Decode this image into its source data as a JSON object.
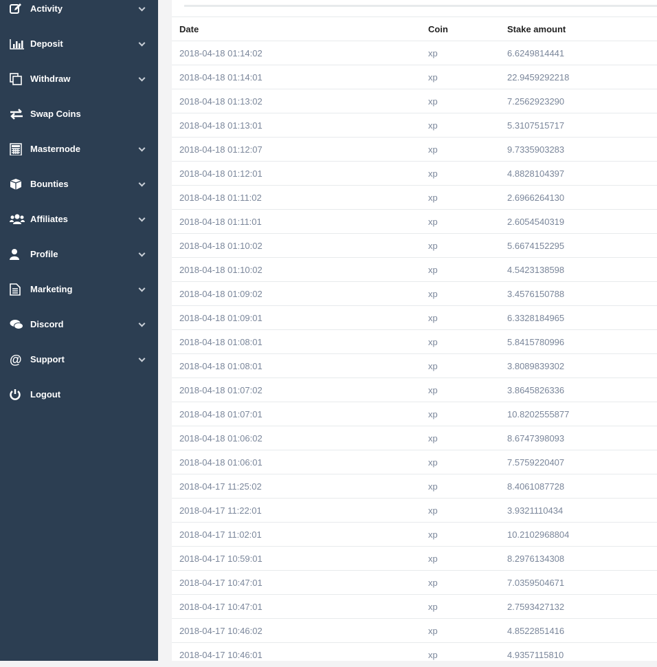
{
  "sidebar": {
    "items": [
      {
        "label": "Activity",
        "icon": "edit-icon",
        "chevron": true
      },
      {
        "label": "Deposit",
        "icon": "bar-chart-icon",
        "chevron": true
      },
      {
        "label": "Withdraw",
        "icon": "copy-icon",
        "chevron": true
      },
      {
        "label": "Swap Coins",
        "icon": "exchange-icon",
        "chevron": false
      },
      {
        "label": "Masternode",
        "icon": "calculator-icon",
        "chevron": true
      },
      {
        "label": "Bounties",
        "icon": "cube-icon",
        "chevron": true
      },
      {
        "label": "Affiliates",
        "icon": "users-icon",
        "chevron": true
      },
      {
        "label": "Profile",
        "icon": "user-icon",
        "chevron": true
      },
      {
        "label": "Marketing",
        "icon": "file-text-icon",
        "chevron": true
      },
      {
        "label": "Discord",
        "icon": "comments-icon",
        "chevron": true
      },
      {
        "label": "Support",
        "icon": "at-icon",
        "chevron": true
      },
      {
        "label": "Logout",
        "icon": "power-icon",
        "chevron": false
      }
    ]
  },
  "table": {
    "headers": [
      "Date",
      "Coin",
      "Stake amount"
    ],
    "rows": [
      [
        "2018-04-18 01:14:02",
        "xp",
        "6.6249814441"
      ],
      [
        "2018-04-18 01:14:01",
        "xp",
        "22.9459292218"
      ],
      [
        "2018-04-18 01:13:02",
        "xp",
        "7.2562923290"
      ],
      [
        "2018-04-18 01:13:01",
        "xp",
        "5.3107515717"
      ],
      [
        "2018-04-18 01:12:07",
        "xp",
        "9.7335903283"
      ],
      [
        "2018-04-18 01:12:01",
        "xp",
        "4.8828104397"
      ],
      [
        "2018-04-18 01:11:02",
        "xp",
        "2.6966264130"
      ],
      [
        "2018-04-18 01:11:01",
        "xp",
        "2.6054540319"
      ],
      [
        "2018-04-18 01:10:02",
        "xp",
        "5.6674152295"
      ],
      [
        "2018-04-18 01:10:02",
        "xp",
        "4.5423138598"
      ],
      [
        "2018-04-18 01:09:02",
        "xp",
        "3.4576150788"
      ],
      [
        "2018-04-18 01:09:01",
        "xp",
        "6.3328184965"
      ],
      [
        "2018-04-18 01:08:01",
        "xp",
        "5.8415780996"
      ],
      [
        "2018-04-18 01:08:01",
        "xp",
        "3.8089839302"
      ],
      [
        "2018-04-18 01:07:02",
        "xp",
        "3.8645826336"
      ],
      [
        "2018-04-18 01:07:01",
        "xp",
        "10.8202555877"
      ],
      [
        "2018-04-18 01:06:02",
        "xp",
        "8.6747398093"
      ],
      [
        "2018-04-18 01:06:01",
        "xp",
        "7.5759220407"
      ],
      [
        "2018-04-17 11:25:02",
        "xp",
        "8.4061087728"
      ],
      [
        "2018-04-17 11:22:01",
        "xp",
        "3.9321110434"
      ],
      [
        "2018-04-17 11:02:01",
        "xp",
        "10.2102968804"
      ],
      [
        "2018-04-17 10:59:01",
        "xp",
        "8.2976134308"
      ],
      [
        "2018-04-17 10:47:01",
        "xp",
        "7.0359504671"
      ],
      [
        "2018-04-17 10:47:01",
        "xp",
        "2.7593427132"
      ],
      [
        "2018-04-17 10:46:02",
        "xp",
        "4.8522851416"
      ],
      [
        "2018-04-17 10:46:01",
        "xp",
        "4.9357115810"
      ]
    ]
  }
}
